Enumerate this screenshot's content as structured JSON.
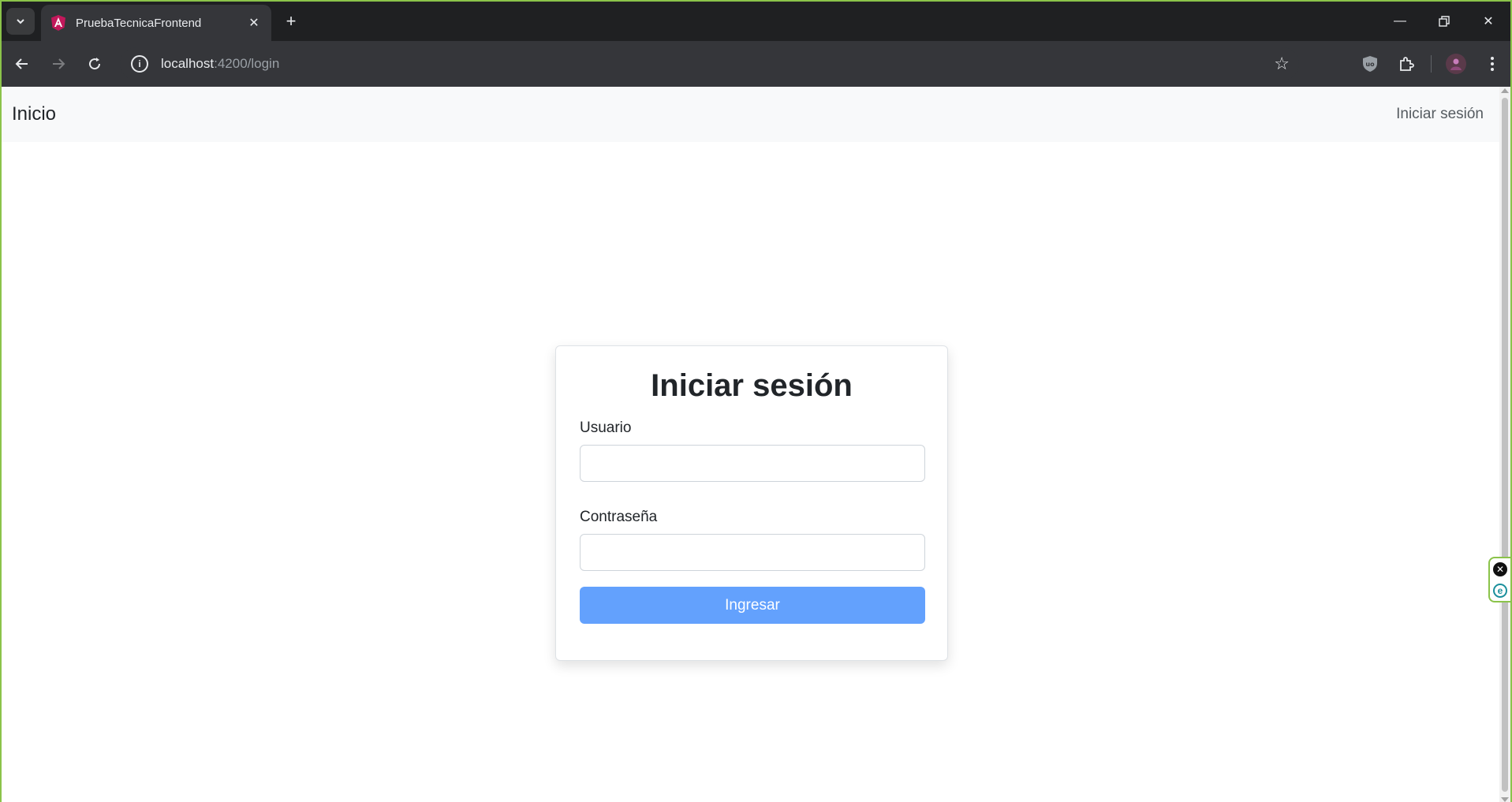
{
  "browser": {
    "tab_title": "PruebaTecnicaFrontend",
    "url_host": "localhost",
    "url_rest": ":4200/login",
    "colors": {
      "frame": "#1f2022",
      "toolbar": "#35363a",
      "window_border": "#8bc34a"
    }
  },
  "navbar": {
    "brand": "Inicio",
    "login_link": "Iniciar sesión"
  },
  "login": {
    "title": "Iniciar sesión",
    "username_label": "Usuario",
    "username_value": "",
    "password_label": "Contraseña",
    "password_value": "",
    "submit_label": "Ingresar",
    "submit_color": "#63a1fd"
  }
}
